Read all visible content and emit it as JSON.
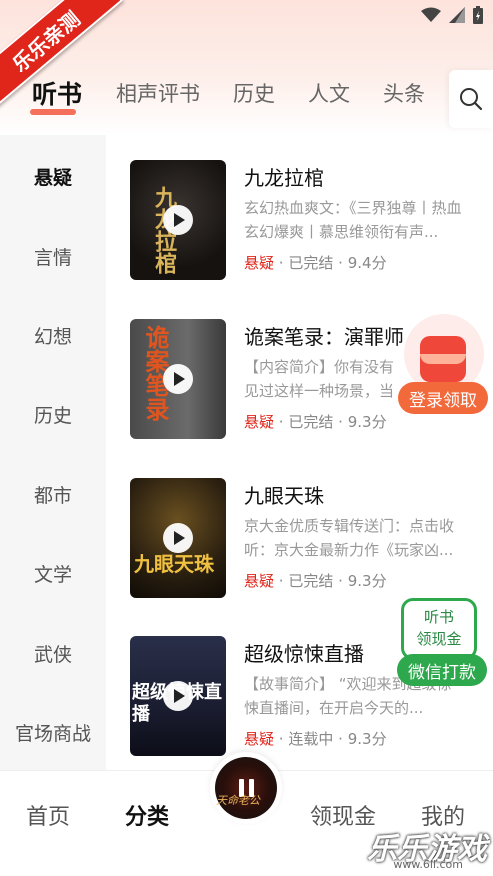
{
  "watermark_top": "乐乐亲测",
  "header": {
    "tabs": [
      {
        "label": "听书",
        "active": true
      },
      {
        "label": "相声评书"
      },
      {
        "label": "历史"
      },
      {
        "label": "人文"
      },
      {
        "label": "头条"
      }
    ],
    "search_icon": "search-icon"
  },
  "sidebar": {
    "items": [
      {
        "label": "悬疑",
        "active": true
      },
      {
        "label": "言情"
      },
      {
        "label": "幻想"
      },
      {
        "label": "历史"
      },
      {
        "label": "都市"
      },
      {
        "label": "文学"
      },
      {
        "label": "武侠"
      },
      {
        "label": "官场商战"
      }
    ]
  },
  "books": [
    {
      "title": "九龙拉棺",
      "desc": "玄幻热血爽文：《三界独尊丨热血玄幻爆爽丨慕思维领衔有声...",
      "category": "悬疑",
      "sep1": "·",
      "status": "已完结",
      "sep2": "·",
      "score": "9.4分",
      "cover_text": "九龙拉棺"
    },
    {
      "title": "诡案笔录：演罪师",
      "desc": "【内容简介】你有没有见过这样一种场景，当你看见某一张凶案现场的照片...",
      "category": "悬疑",
      "sep1": "·",
      "status": "已完结",
      "sep2": "·",
      "score": "9.3分",
      "cover_text": "诡案笔录"
    },
    {
      "title": "九眼天珠",
      "desc": "京大金优质专辑传送门：点击收听：京大金最新力作《玩家凶...",
      "category": "悬疑",
      "sep1": "·",
      "status": "已完结",
      "sep2": "·",
      "score": "9.3分",
      "cover_text": "九眼天珠"
    },
    {
      "title": "超级惊悚直播",
      "desc": "【故事简介】 “欢迎来到超级惊悚直播间，在开启今天的...",
      "category": "悬疑",
      "sep1": "·",
      "status": "连载中",
      "sep2": "·",
      "score": "9.3分",
      "cover_text": "超级惊悚直播"
    }
  ],
  "float_redpacket": {
    "label": "登录领取"
  },
  "float_wechat": {
    "line1": "听书",
    "line2": "领现金",
    "button": "微信打款"
  },
  "bottom_nav": [
    {
      "label": "首页"
    },
    {
      "label": "分类",
      "active": true
    },
    {
      "label": "领现金"
    },
    {
      "label": "我的"
    }
  ],
  "player": {
    "cover_text": "天命老公"
  },
  "watermark_bottom": {
    "text": "乐乐游戏",
    "url": "www.6ll.com"
  },
  "colors": {
    "accent": "#e0261b",
    "tab_underline": "#f3583f",
    "wechat_green": "#2ea84d"
  }
}
